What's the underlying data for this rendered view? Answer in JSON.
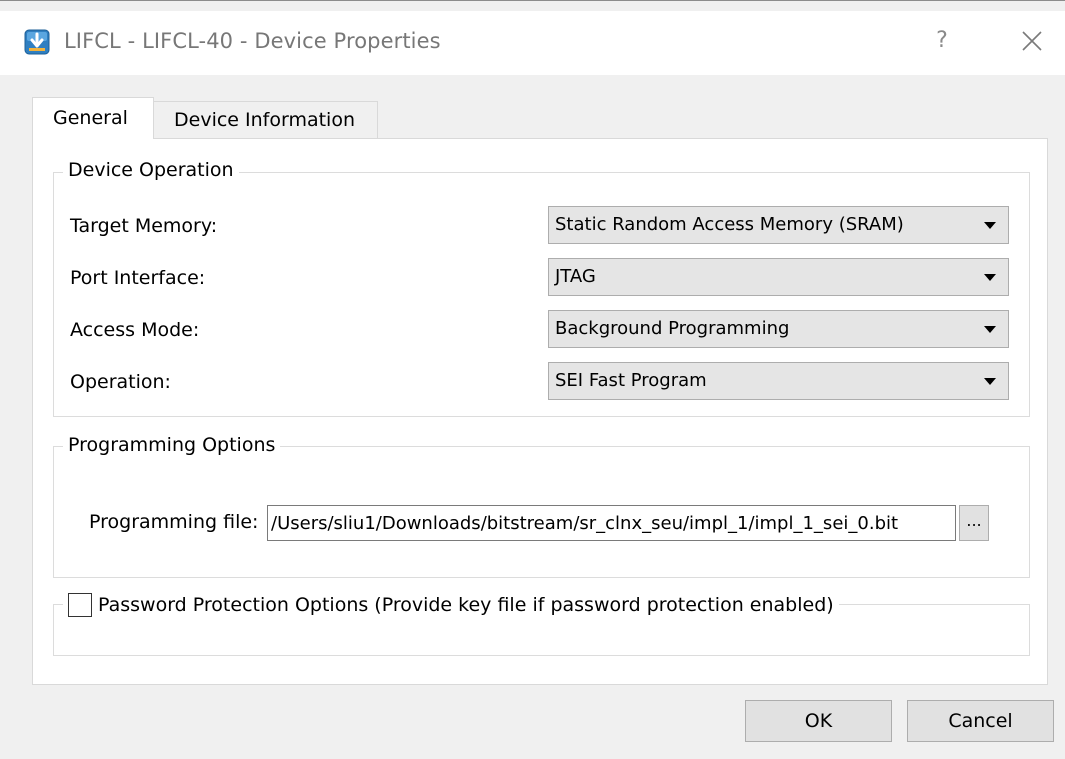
{
  "window": {
    "title": "LIFCL - LIFCL-40 - Device Properties",
    "help_label": "?"
  },
  "tabs": [
    {
      "label": "General",
      "active": true
    },
    {
      "label": "Device Information",
      "active": false
    }
  ],
  "device_operation": {
    "legend": "Device Operation",
    "fields": [
      {
        "label": "Target Memory:",
        "value": "Static Random Access Memory (SRAM)"
      },
      {
        "label": "Port Interface:",
        "value": "JTAG"
      },
      {
        "label": "Access Mode:",
        "value": "Background Programming"
      },
      {
        "label": "Operation:",
        "value": "SEI Fast Program"
      }
    ]
  },
  "programming_options": {
    "legend": "Programming Options",
    "file_label": "Programming file:",
    "file_value": "/Users/sliu1/Downloads/bitstream/sr_clnx_seu/impl_1/impl_1_sei_0.bit",
    "browse_label": "..."
  },
  "password": {
    "label": "Password Protection Options (Provide key file if password protection enabled)",
    "checked": false
  },
  "buttons": {
    "ok": "OK",
    "cancel": "Cancel"
  },
  "colors": {
    "dialog_bg": "#f0f0f0",
    "panel_bg": "#ffffff",
    "combo_bg": "#e5e5e5",
    "button_bg": "#e1e1e1",
    "icon_blue": "#2f7fc1"
  },
  "icons": [
    "app-download-icon",
    "help-icon",
    "close-icon",
    "chevron-down-icon"
  ]
}
